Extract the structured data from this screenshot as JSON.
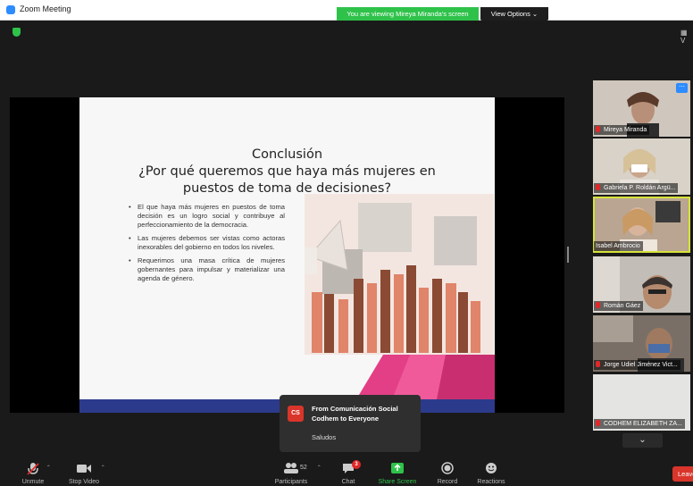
{
  "window": {
    "title": "Zoom Meeting"
  },
  "banner": {
    "viewing_text": "You are viewing Mireya Miranda's screen",
    "view_options": "View Options ⌄"
  },
  "slide": {
    "title_line1": "Conclusión",
    "title_line2": "¿Por qué queremos que haya más mujeres en",
    "title_line3": "puestos de toma de decisiones?",
    "bullets": [
      "El que haya más mujeres en puestos de toma decisión es un logro social y contribuye al perfeccionamiento de la democracia.",
      "Las mujeres debemos ser vistas como actoras inexorables del gobierno en todos los niveles.",
      "Requerimos una masa crítica de mujeres gobernantes para impulsar y materializar una agenda de género."
    ]
  },
  "participants": [
    {
      "name": "Mireya Miranda",
      "muted": true,
      "bg": "#cfc6bd"
    },
    {
      "name": "Gabriela P. Roldán Argü...",
      "muted": true,
      "bg": "#d8d2c8"
    },
    {
      "name": "Isabel Ambrocio",
      "muted": false,
      "bg": "#b9a591"
    },
    {
      "name": "Román Gáez",
      "muted": true,
      "bg": "#c2bdb6"
    },
    {
      "name": "Jorge Udiel Jiménez Vict...",
      "muted": true,
      "bg": "#7a6f66"
    },
    {
      "name": "CODHEM ELIZABETH ZA...",
      "muted": true,
      "bg": "#e4e4e2"
    }
  ],
  "chat": {
    "avatar_initials": "CS",
    "from_line1": "From Comunicación Social",
    "from_line2": "Codhem to Everyone",
    "message": "Saludos"
  },
  "toolbar": {
    "unmute": "Unmute",
    "stop_video": "Stop Video",
    "participants": "Participants",
    "participants_count": "52",
    "chat": "Chat",
    "chat_badge": "3",
    "share_screen": "Share Screen",
    "record": "Record",
    "reactions": "Reactions",
    "leave": "Leave"
  },
  "colors": {
    "share_green": "#2fc24a",
    "zoom_blue": "#2d8cff",
    "leave_red": "#d9352b"
  }
}
